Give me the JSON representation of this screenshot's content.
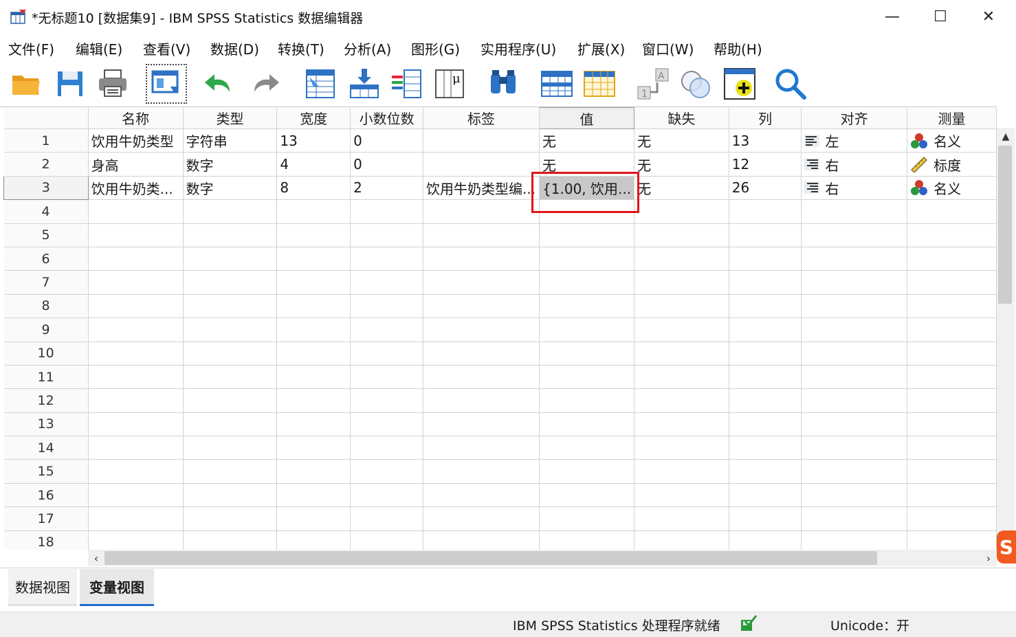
{
  "window": {
    "title": "*无标题10 [数据集9] - IBM SPSS Statistics 数据编辑器",
    "minimize_glyph": "—",
    "maximize_glyph": "☐",
    "close_glyph": "✕"
  },
  "menu": [
    "文件(F)",
    "编辑(E)",
    "查看(V)",
    "数据(D)",
    "转换(T)",
    "分析(A)",
    "图形(G)",
    "实用程序(U)",
    "扩展(X)",
    "窗口(W)",
    "帮助(H)"
  ],
  "toolbar_icons": [
    "open-folder-icon",
    "save-icon",
    "print-icon",
    "recall-dialog-icon",
    "undo-icon",
    "redo-icon",
    "goto-case-icon",
    "goto-variable-icon",
    "variables-icon",
    "run-descriptives-icon",
    "find-icon",
    "insert-cases-icon",
    "insert-variable-icon",
    "split-file-icon",
    "weight-cases-icon",
    "select-cases-icon",
    "value-labels-icon",
    "use-variable-sets-icon",
    "search-icon"
  ],
  "grid": {
    "columns": [
      "名称",
      "类型",
      "宽度",
      "小数位数",
      "标签",
      "值",
      "缺失",
      "列",
      "对齐",
      "测量"
    ],
    "rows": [
      {
        "n": "1",
        "name": "饮用牛奶类型",
        "type": "字符串",
        "width": "13",
        "decimals": "0",
        "label": "",
        "values": "无",
        "missing": "无",
        "columns": "13",
        "align": "左",
        "measure": "名义"
      },
      {
        "n": "2",
        "name": "身高",
        "type": "数字",
        "width": "4",
        "decimals": "0",
        "label": "",
        "values": "无",
        "missing": "无",
        "columns": "12",
        "align": "右",
        "measure": "标度"
      },
      {
        "n": "3",
        "name": "饮用牛奶类...",
        "type": "数字",
        "width": "8",
        "decimals": "2",
        "label": "饮用牛奶类型编...",
        "values": "{1.00, 饮用...",
        "missing": "无",
        "columns": "26",
        "align": "右",
        "measure": "名义"
      }
    ],
    "empty_rows": [
      "4",
      "5",
      "6",
      "7",
      "8",
      "9",
      "10",
      "11",
      "12",
      "13",
      "14",
      "15",
      "16",
      "17",
      "18"
    ]
  },
  "tabs": {
    "data_view": "数据视图",
    "variable_view": "变量视图"
  },
  "status": {
    "processor": "IBM SPSS Statistics 处理程序就绪",
    "unicode": "Unicode：开"
  },
  "accent": {
    "highlight": "#e0141b",
    "tab_underline": "#1f6ec9"
  }
}
